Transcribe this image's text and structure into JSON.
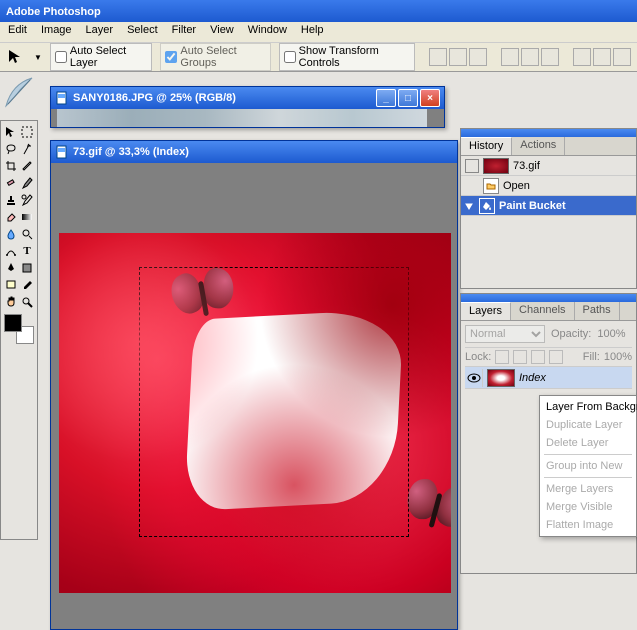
{
  "app": {
    "title": "Adobe Photoshop"
  },
  "menu": {
    "items": [
      "Edit",
      "Image",
      "Layer",
      "Select",
      "Filter",
      "View",
      "Window",
      "Help"
    ]
  },
  "options": {
    "auto_select_layer": "Auto Select Layer",
    "auto_select_groups": "Auto Select Groups",
    "show_transform": "Show Transform Controls"
  },
  "documents": {
    "doc1": {
      "title": "SANY0186.JPG @ 25% (RGB/8)"
    },
    "doc2": {
      "title": "73.gif @ 33,3% (Index)"
    }
  },
  "history": {
    "tab_history": "History",
    "tab_actions": "Actions",
    "file": "73.gif",
    "steps": [
      "Open",
      "Paint Bucket"
    ]
  },
  "layers": {
    "tab_layers": "Layers",
    "tab_channels": "Channels",
    "tab_paths": "Paths",
    "blend_mode": "Normal",
    "opacity_label": "Opacity:",
    "opacity_value": "100%",
    "lock_label": "Lock:",
    "fill_label": "Fill:",
    "fill_value": "100%",
    "layer_name": "Index"
  },
  "context_menu": {
    "items": [
      "Layer From Background",
      "Duplicate Layer",
      "Delete Layer",
      "Group into New",
      "Merge Layers",
      "Merge Visible",
      "Flatten Image"
    ]
  }
}
